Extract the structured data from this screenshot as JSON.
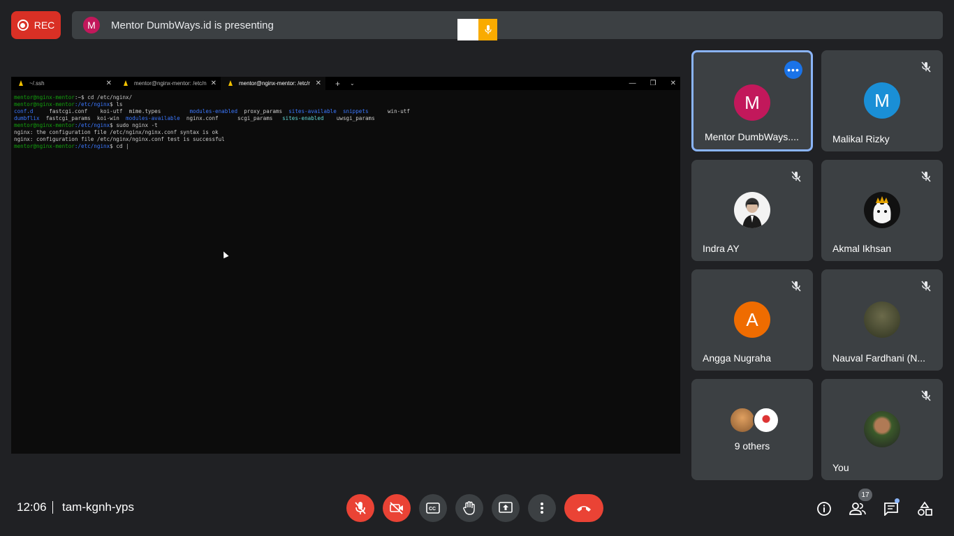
{
  "top_bar": {
    "rec_label": "REC",
    "presenter_initial": "M",
    "presenting_text": "Mentor DumbWays.id is presenting"
  },
  "terminal": {
    "tabs": [
      {
        "label": "~/.ssh"
      },
      {
        "label": "mentor@nginx-mentor: /etc/n"
      },
      {
        "label": "mentor@nginx-mentor: /etc/r"
      }
    ],
    "add_tab": "+",
    "dropdown": "⌄",
    "lines": {
      "l1_prompt": "mentor@nginx-mentor",
      "l1_path": ":~$",
      "l1_cmd": " cd /etc/nginx/",
      "l2_prompt": "mentor@nginx-mentor",
      "l2_path": ":/etc/nginx",
      "l2_cmd": "$ ls",
      "l3_a": "conf.d",
      "l3_b": "     fastcgi.conf    koi-utf  mime.types         ",
      "l3_c": "modules-enabled",
      "l3_d": "  proxy_params  ",
      "l3_e": "sites-available",
      "l3_f": "  ",
      "l3_g": "snippets",
      "l3_h": "      win-utf",
      "l4_a": "dumbflix",
      "l4_b": "  fastcgi_params  koi-win  ",
      "l4_c": "modules-available",
      "l4_d": "  nginx.conf      scgi_params   ",
      "l4_e": "sites-enabled",
      "l4_f": "    uwsgi_params",
      "l5_prompt": "mentor@nginx-mentor",
      "l5_path": ":/etc/nginx",
      "l5_cmd": "$ sudo nginx -t",
      "l6": "nginx: the configuration file /etc/nginx/nginx.conf syntax is ok",
      "l7": "nginx: configuration file /etc/nginx/nginx.conf test is successful",
      "l8_prompt": "mentor@nginx-mentor",
      "l8_path": ":/etc/nginx",
      "l8_cmd": "$ cd |"
    }
  },
  "participants": [
    {
      "name": "Mentor DumbWays....",
      "initial": "M",
      "color": "#c2185b"
    },
    {
      "name": "Malikal Rizky",
      "initial": "M",
      "color": "#1a8fd6"
    },
    {
      "name": "Indra AY",
      "initial": "",
      "color": "#e0e0e0"
    },
    {
      "name": "Akmal Ikhsan",
      "initial": "",
      "color": "#111111"
    },
    {
      "name": "Angga Nugraha",
      "initial": "A",
      "color": "#ef6c00"
    },
    {
      "name": "Nauval Fardhani (N...",
      "initial": "",
      "color": "#4e5a3a"
    },
    {
      "name": "9 others",
      "initial": "",
      "color": "#3c4043"
    },
    {
      "name": "You",
      "initial": "",
      "color": "#5a3b2a"
    }
  ],
  "more_options": "•••",
  "bottom_bar": {
    "time": "12:06",
    "meeting_code": "tam-kgnh-yps",
    "people_count": "17"
  },
  "icons": {
    "mic_off": "mic-off-icon",
    "cam_off": "camera-off-icon",
    "captions": "captions-icon",
    "hand": "raise-hand-icon",
    "present": "present-screen-icon",
    "more": "more-vert-icon",
    "end": "end-call-icon",
    "info": "info-icon",
    "people": "people-icon",
    "chat": "chat-icon",
    "activities": "activities-icon"
  }
}
